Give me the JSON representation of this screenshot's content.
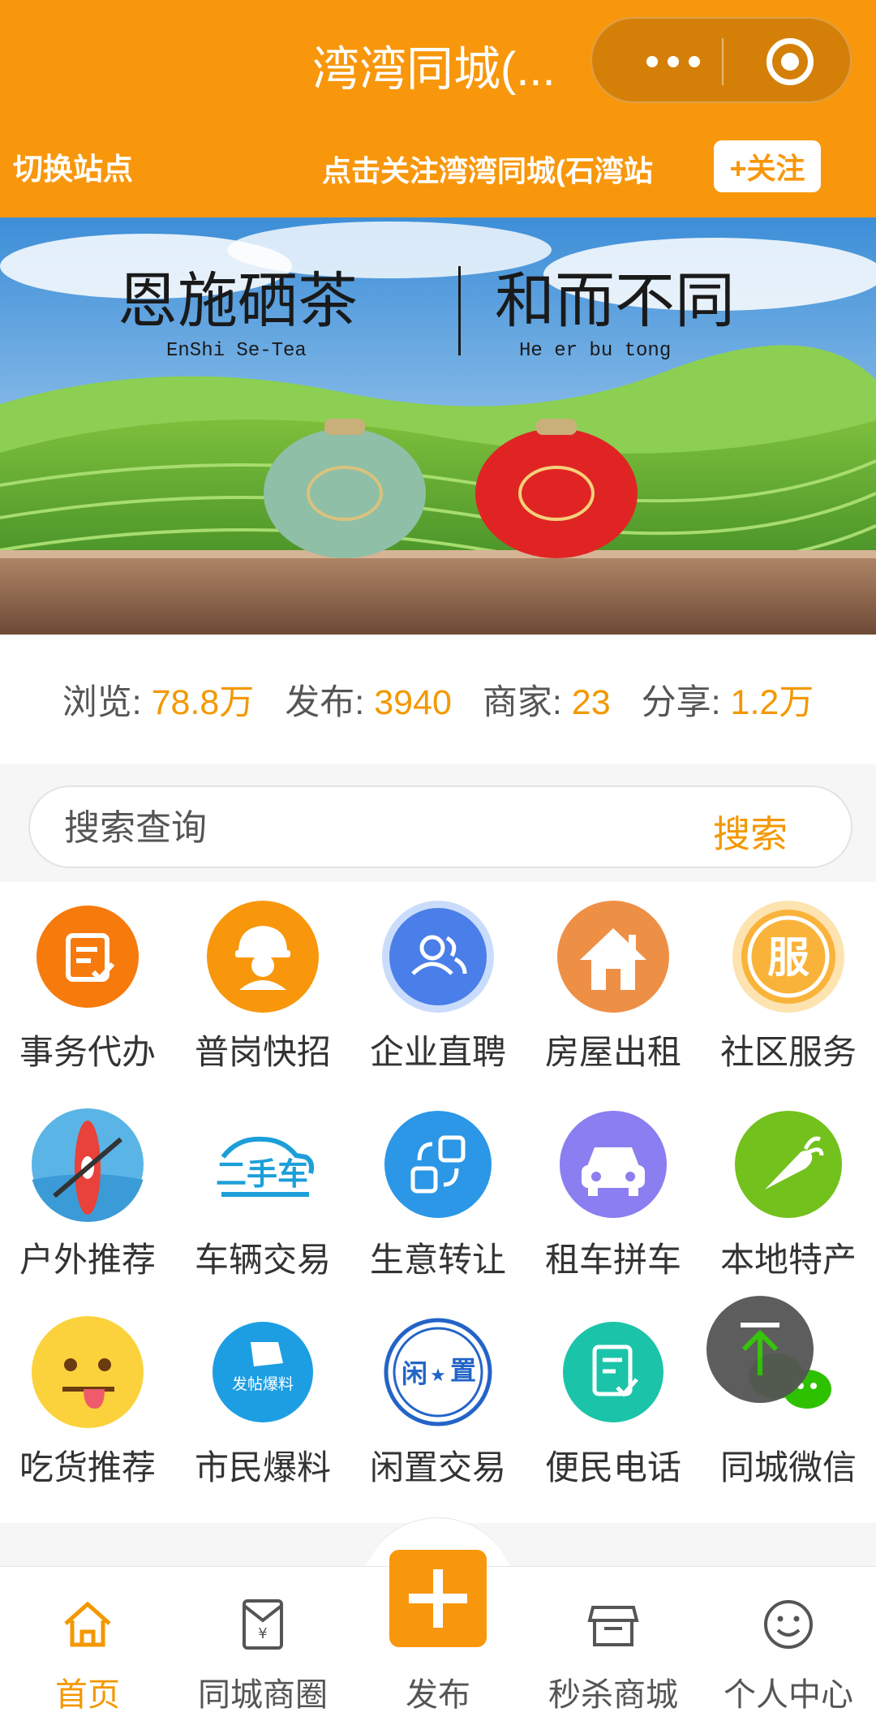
{
  "header": {
    "title": "湾湾同城(...",
    "switch_site": "切换站点",
    "follow_tip": "点击关注湾湾同城(石湾站",
    "follow_button": "+关注",
    "accent_color": "#f8970c"
  },
  "banner": {
    "left_title": "恩施硒茶",
    "left_subtitle": "EnShi Se-Tea",
    "right_title": "和而不同",
    "right_subtitle": "He er bu tong"
  },
  "stats": [
    {
      "label": "浏览:",
      "value": "78.8万"
    },
    {
      "label": "发布:",
      "value": "3940"
    },
    {
      "label": "商家:",
      "value": "23"
    },
    {
      "label": "分享:",
      "value": "1.2万"
    }
  ],
  "search": {
    "placeholder": "搜索查询",
    "button": "搜索"
  },
  "grid": [
    {
      "label": "事务代办",
      "icon": "edit-doc-icon"
    },
    {
      "label": "普岗快招",
      "icon": "worker-icon"
    },
    {
      "label": "企业直聘",
      "icon": "users-icon"
    },
    {
      "label": "房屋出租",
      "icon": "house-icon"
    },
    {
      "label": "社区服务",
      "icon": "service-icon"
    },
    {
      "label": "户外推荐",
      "icon": "kayak-icon"
    },
    {
      "label": "车辆交易",
      "icon": "used-car-icon"
    },
    {
      "label": "生意转让",
      "icon": "transfer-icon"
    },
    {
      "label": "租车拼车",
      "icon": "car-icon"
    },
    {
      "label": "本地特产",
      "icon": "carrot-icon"
    },
    {
      "label": "吃货推荐",
      "icon": "foodie-emoji-icon"
    },
    {
      "label": "市民爆料",
      "icon": "post-news-icon"
    },
    {
      "label": "闲置交易",
      "icon": "idle-stamp-icon"
    },
    {
      "label": "便民电话",
      "icon": "phone-doc-icon"
    },
    {
      "label": "同城微信",
      "icon": "wechat-icon"
    }
  ],
  "grid_text": {
    "used_car": "二手车",
    "post_news": "发帖爆料",
    "idle_1": "闲",
    "idle_2": "置",
    "service": "服"
  },
  "tabbar": [
    {
      "label": "首页",
      "icon": "home-icon",
      "active": true
    },
    {
      "label": "同城商圈",
      "icon": "shop-bag-icon",
      "active": false
    },
    {
      "label": "发布",
      "icon": "plus-icon",
      "active": false
    },
    {
      "label": "秒杀商城",
      "icon": "store-icon",
      "active": false
    },
    {
      "label": "个人中心",
      "icon": "smile-icon",
      "active": false
    }
  ]
}
